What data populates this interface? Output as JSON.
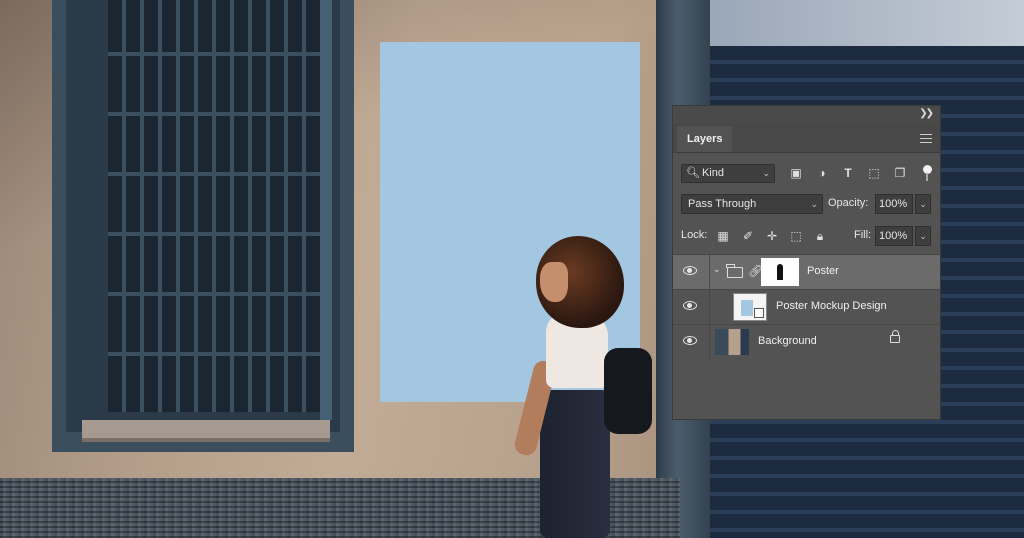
{
  "panel": {
    "collapse_icon": "double-chevron-icon",
    "tab_label": "Layers",
    "menu_icon": "hamburger-icon"
  },
  "filter": {
    "kind_label": "Kind",
    "icons": [
      "search-icon",
      "image-filter-icon",
      "adjustment-filter-icon",
      "type-filter-icon",
      "shape-filter-icon",
      "smart-object-filter-icon"
    ]
  },
  "blend": {
    "mode": "Pass Through",
    "opacity_label": "Opacity:",
    "opacity_value": "100%"
  },
  "lock": {
    "label": "Lock:",
    "icons": [
      "lock-transparent-icon",
      "lock-image-icon",
      "lock-position-icon",
      "lock-artboard-icon",
      "lock-all-icon"
    ],
    "fill_label": "Fill:",
    "fill_value": "100%"
  },
  "layers": [
    {
      "name": "Poster",
      "type": "group",
      "selected": true,
      "visible": true
    },
    {
      "name": "Poster Mockup Design",
      "type": "smart-object",
      "selected": false,
      "visible": true
    },
    {
      "name": "Background",
      "type": "pixel",
      "selected": false,
      "visible": true,
      "locked": true
    }
  ],
  "colors": {
    "panel_bg": "#535353",
    "selected_row": "#6b6b6b",
    "poster": "#a3c7e0"
  }
}
